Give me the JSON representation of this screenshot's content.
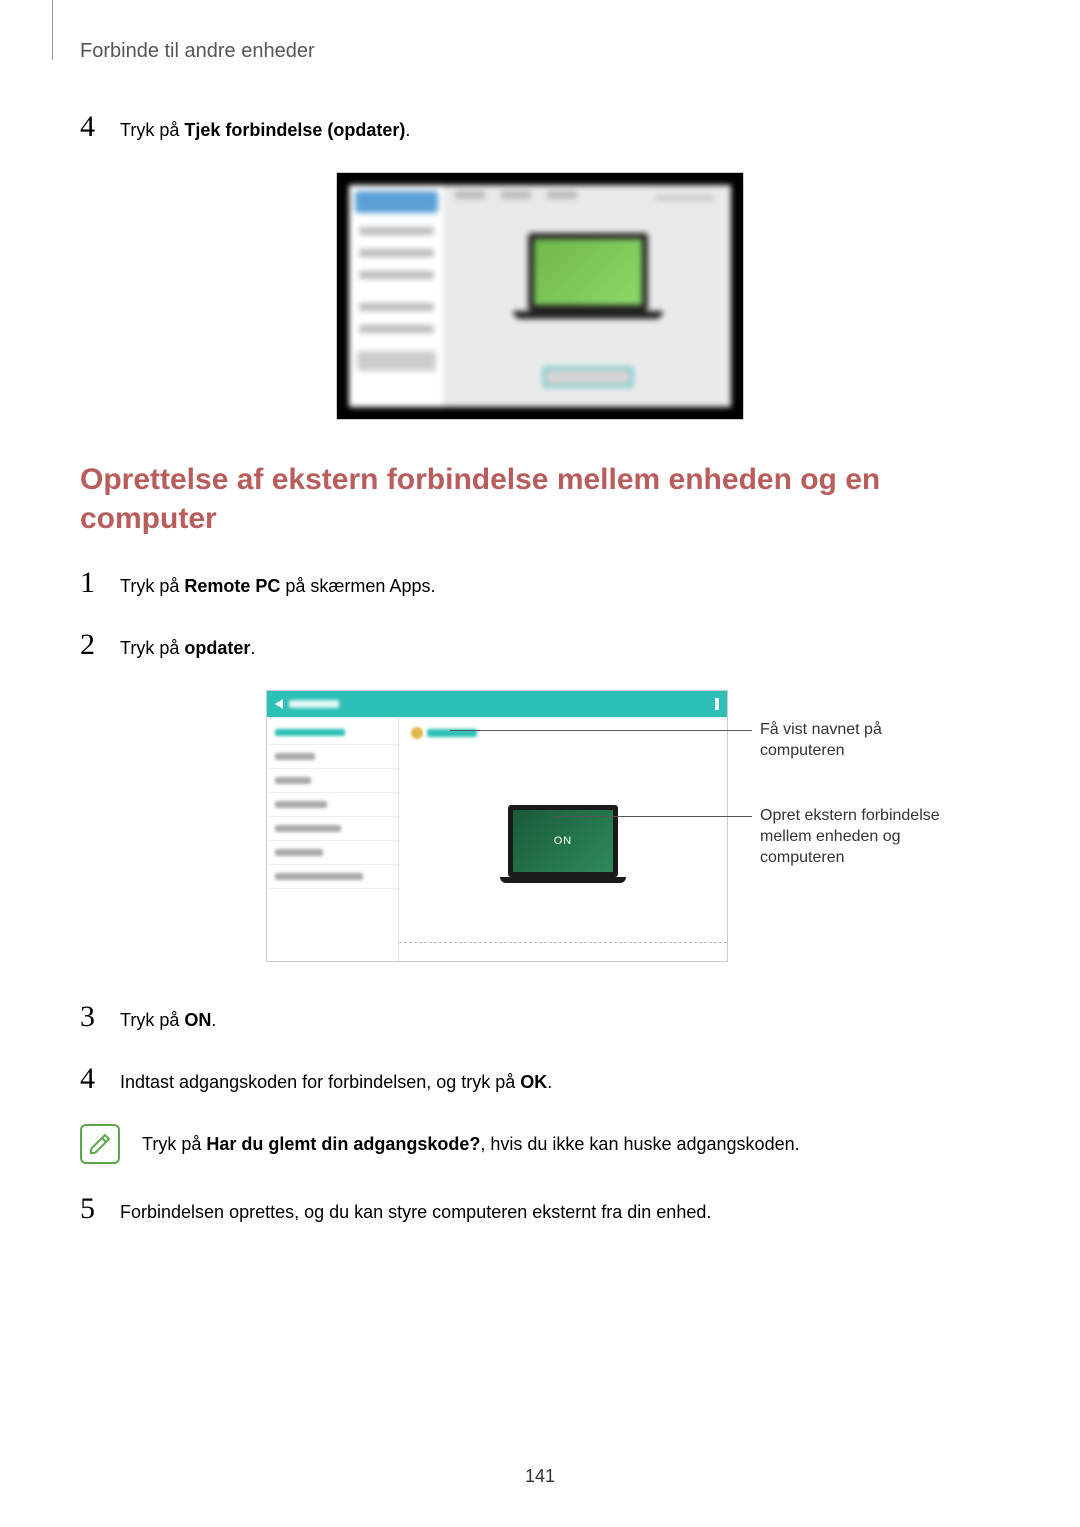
{
  "header": {
    "breadcrumb": "Forbinde til andre enheder"
  },
  "top_step": {
    "num": "4",
    "prefix": "Tryk på ",
    "bold": "Tjek forbindelse (opdater)",
    "suffix": "."
  },
  "section_heading": "Oprettelse af ekstern forbindelse mellem enheden og en computer",
  "steps": {
    "s1": {
      "num": "1",
      "prefix": "Tryk på ",
      "bold": "Remote PC",
      "suffix": " på skærmen Apps."
    },
    "s2": {
      "num": "2",
      "prefix": "Tryk på ",
      "bold": "opdater",
      "suffix": "."
    },
    "s3": {
      "num": "3",
      "prefix": "Tryk på ",
      "bold": "ON",
      "suffix": "."
    },
    "s4": {
      "num": "4",
      "prefix": "Indtast adgangskoden for forbindelsen, og tryk på ",
      "bold": "OK",
      "suffix": "."
    },
    "s5": {
      "num": "5",
      "text": "Forbindelsen oprettes, og du kan styre computeren eksternt fra din enhed."
    }
  },
  "fig2": {
    "on_label": "ON",
    "callout1": "Få vist navnet på computeren",
    "callout2": "Opret ekstern forbindelse mellem enheden og computeren"
  },
  "note": {
    "prefix": "Tryk på ",
    "bold": "Har du glemt din adgangskode?",
    "suffix": ", hvis du ikke kan huske adgangskoden."
  },
  "page_number": "141"
}
